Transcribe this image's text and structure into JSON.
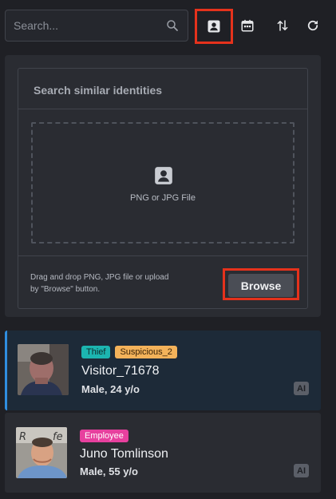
{
  "search": {
    "placeholder": "Search..."
  },
  "toolbar": {
    "icons": [
      "search-icon",
      "contact-card-icon",
      "calendar-icon",
      "sort-icon",
      "refresh-icon"
    ],
    "active": "contact-card-icon",
    "highlight_color": "#e5321c"
  },
  "upload": {
    "title": "Search similar identities",
    "dropzone_label": "PNG or JPG File",
    "hint_line1": "Drag and drop PNG, JPG file or upload",
    "hint_line2": "by \"Browse\" button.",
    "browse_label": "Browse"
  },
  "identities": [
    {
      "tags": [
        {
          "label": "Thief",
          "color": "#1cb5b0"
        },
        {
          "label": "Suspicious_2",
          "color": "#f3b25a"
        }
      ],
      "name": "Visitor_71678",
      "meta": "Male, 24 y/o",
      "badge": "AI",
      "selected": true
    },
    {
      "tags": [
        {
          "label": "Employee",
          "color": "#e7409e"
        }
      ],
      "name": "Juno Tomlinson",
      "meta": "Male, 55 y/o",
      "badge": "AI",
      "selected": false
    }
  ]
}
